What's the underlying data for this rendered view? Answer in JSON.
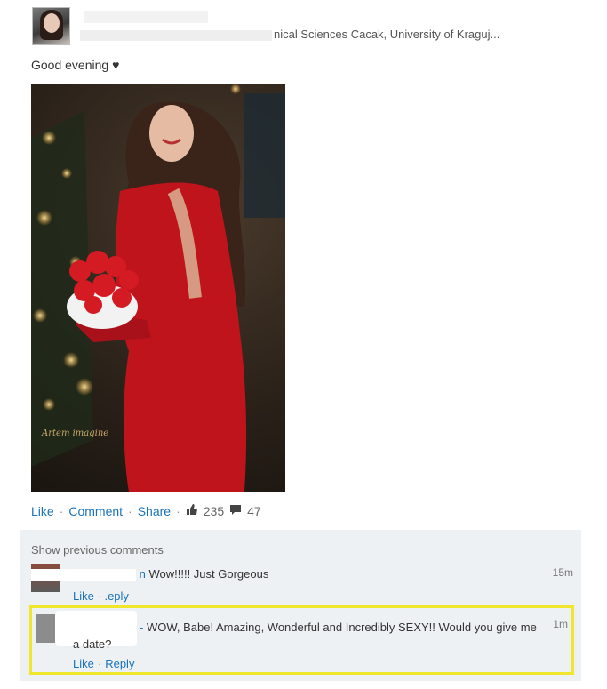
{
  "post": {
    "headline_text": "As... ...rofessor at Faculty of Technical Sciences Cacak, University of Kraguj...",
    "headline_visible": "nical Sciences Cacak, University of Kraguj...",
    "text": "Good evening ♥",
    "photo_watermark": "Artem imagine",
    "actions": {
      "like": "Like",
      "comment": "Comment",
      "share": "Share",
      "sep": "·",
      "likes_count": "235",
      "comments_count": "47"
    }
  },
  "comments": {
    "show_previous": "Show previous comments",
    "items": [
      {
        "name_tail": "n",
        "text": "Wow!!!!! Just Gorgeous",
        "time": "15m",
        "like": "Like",
        "sep": "·",
        "reply": "Reply",
        "reply_visible": ".eply"
      },
      {
        "name_tail": "-",
        "text": "WOW, Babe! Amazing, Wonderful and Incredibly SEXY!! Would you give me a date?",
        "time": "1m",
        "like": "Like",
        "sep": "·",
        "reply": "Reply"
      }
    ]
  },
  "colors": {
    "link": "#1a73ba",
    "highlight_border": "#f0e62b",
    "comments_bg": "#eef1f3"
  }
}
